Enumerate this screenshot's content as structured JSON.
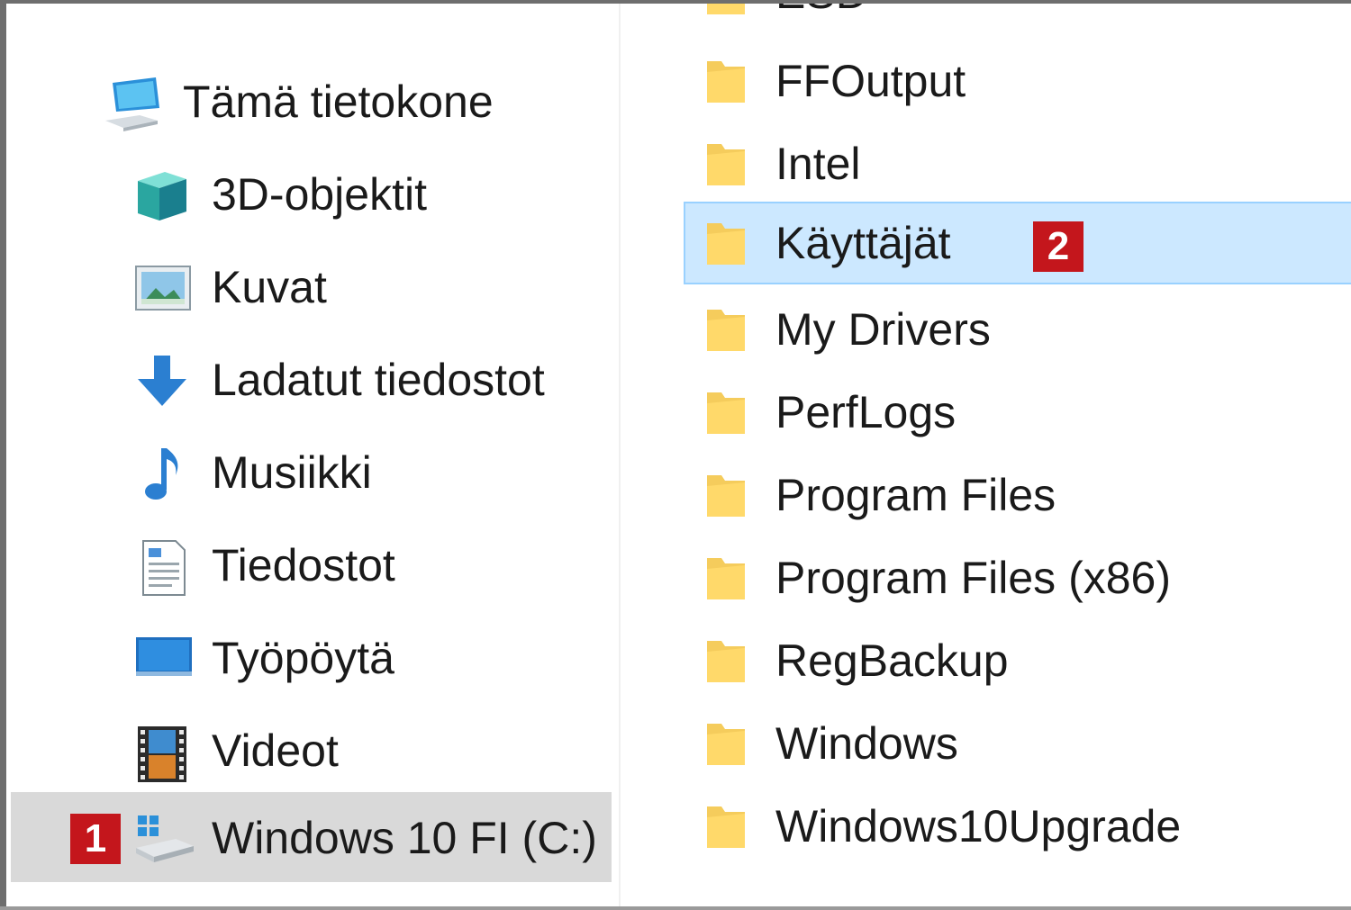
{
  "nav": {
    "root": {
      "label": "Tämä tietokone",
      "icon": "this-pc-icon"
    },
    "items": [
      {
        "label": "3D-objektit",
        "icon": "3d-objects-icon"
      },
      {
        "label": "Kuvat",
        "icon": "pictures-icon"
      },
      {
        "label": "Ladatut tiedostot",
        "icon": "downloads-icon"
      },
      {
        "label": "Musiikki",
        "icon": "music-icon"
      },
      {
        "label": "Tiedostot",
        "icon": "documents-icon"
      },
      {
        "label": "Työpöytä",
        "icon": "desktop-icon"
      },
      {
        "label": "Videot",
        "icon": "videos-icon"
      }
    ],
    "drive": {
      "label": "Windows 10 FI (C:)",
      "icon": "drive-c-icon",
      "badge": "1"
    }
  },
  "folders": [
    {
      "label": "ESD"
    },
    {
      "label": "FFOutput"
    },
    {
      "label": "Intel"
    },
    {
      "label": "Käyttäjät",
      "badge": "2"
    },
    {
      "label": "My Drivers"
    },
    {
      "label": "PerfLogs"
    },
    {
      "label": "Program Files"
    },
    {
      "label": "Program Files (x86)"
    },
    {
      "label": "RegBackup"
    },
    {
      "label": "Windows"
    },
    {
      "label": "Windows10Upgrade"
    }
  ],
  "colors": {
    "selection_nav": "#d9d9d9",
    "selection_content": "#cce8ff",
    "selection_border": "#99d1ff",
    "badge": "#c4161c",
    "folder": "#f5cc5c"
  }
}
